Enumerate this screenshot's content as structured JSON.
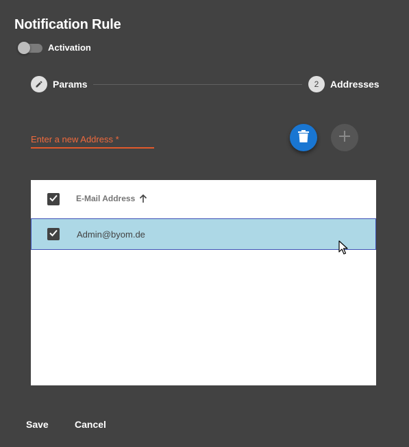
{
  "dialog": {
    "title": "Notification Rule"
  },
  "activation": {
    "label": "Activation",
    "enabled": false
  },
  "stepper": {
    "steps": [
      {
        "label": "Params",
        "icon": "pencil-icon",
        "state": "edit"
      },
      {
        "label": "Addresses",
        "number": "2",
        "state": "active"
      }
    ]
  },
  "address_input": {
    "placeholder": "Enter a new Address *",
    "value": ""
  },
  "actions": {
    "delete_icon": "trash-icon",
    "add_icon": "plus-icon"
  },
  "table": {
    "columns": [
      {
        "label": "E-Mail Address",
        "sort": "ascending"
      }
    ],
    "header_checked": true,
    "rows": [
      {
        "email": "Admin@byom.de",
        "checked": true,
        "selected": true
      }
    ]
  },
  "footer": {
    "save_label": "Save",
    "cancel_label": "Cancel"
  },
  "colors": {
    "background": "#424242",
    "accent_blue": "#1976d2",
    "error_orange": "#e35a2b",
    "row_selected": "#add8e6"
  }
}
